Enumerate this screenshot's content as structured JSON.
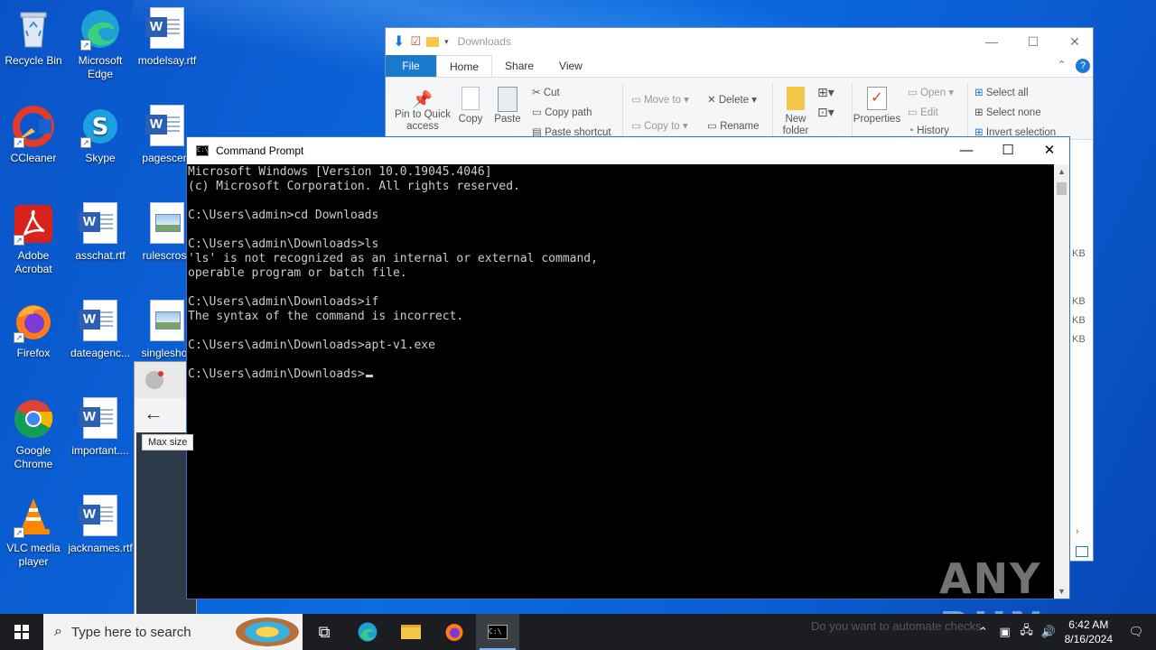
{
  "desktop": {
    "icons": [
      {
        "label": "Recycle Bin",
        "icon": "recycle-bin-icon"
      },
      {
        "label": "Microsoft Edge",
        "icon": "edge-icon"
      },
      {
        "label": "modelsay.rtf",
        "icon": "word-doc-icon"
      },
      {
        "label": "CCleaner",
        "icon": "ccleaner-icon"
      },
      {
        "label": "Skype",
        "icon": "skype-icon"
      },
      {
        "label": "pagescent",
        "icon": "word-doc-icon"
      },
      {
        "label": "Adobe Acrobat",
        "icon": "acrobat-icon"
      },
      {
        "label": "asschat.rtf",
        "icon": "word-doc-icon"
      },
      {
        "label": "rulescross",
        "icon": "image-doc-icon"
      },
      {
        "label": "Firefox",
        "icon": "firefox-icon"
      },
      {
        "label": "dateagenc...",
        "icon": "word-doc-icon"
      },
      {
        "label": "singleshov",
        "icon": "image-doc-icon"
      },
      {
        "label": "Google Chrome",
        "icon": "chrome-icon"
      },
      {
        "label": "important....",
        "icon": "word-doc-icon"
      },
      {
        "label": "VLC media player",
        "icon": "vlc-icon"
      },
      {
        "label": "jacknames.rtf",
        "icon": "word-doc-icon"
      }
    ]
  },
  "explorer": {
    "title": "Downloads",
    "tabs": [
      "File",
      "Home",
      "Share",
      "View"
    ],
    "ribbon": {
      "pin": "Pin to Quick access",
      "copy": "Copy",
      "paste": "Paste",
      "cut": "Cut",
      "copy_path": "Copy path",
      "paste_shortcut": "Paste shortcut",
      "move_to": "Move to",
      "copy_to": "Copy to",
      "delete": "Delete",
      "rename": "Rename",
      "new_folder": "New folder",
      "properties": "Properties",
      "open": "Open",
      "edit": "Edit",
      "history": "History",
      "select_all": "Select all",
      "select_none": "Select none",
      "invert_selection": "Invert selection"
    },
    "side_sizes": [
      "KB",
      "KB",
      "KB",
      "KB"
    ]
  },
  "background_window": {
    "tooltip": "Max size"
  },
  "cmd": {
    "title": "Command Prompt",
    "output": "Microsoft Windows [Version 10.0.19045.4046]\n(c) Microsoft Corporation. All rights reserved.\n\nC:\\Users\\admin>cd Downloads\n\nC:\\Users\\admin\\Downloads>ls\n'ls' is not recognized as an internal or external command,\noperable program or batch file.\n\nC:\\Users\\admin\\Downloads>if\nThe syntax of the command is incorrect.\n\nC:\\Users\\admin\\Downloads>apt-v1.exe\n\nC:\\Users\\admin\\Downloads>"
  },
  "watermark": "ANY RUN",
  "taskbar": {
    "search_placeholder": "Type here to search",
    "notice": "Do you want to automate checks",
    "time": "6:42 AM",
    "date": "8/16/2024"
  }
}
